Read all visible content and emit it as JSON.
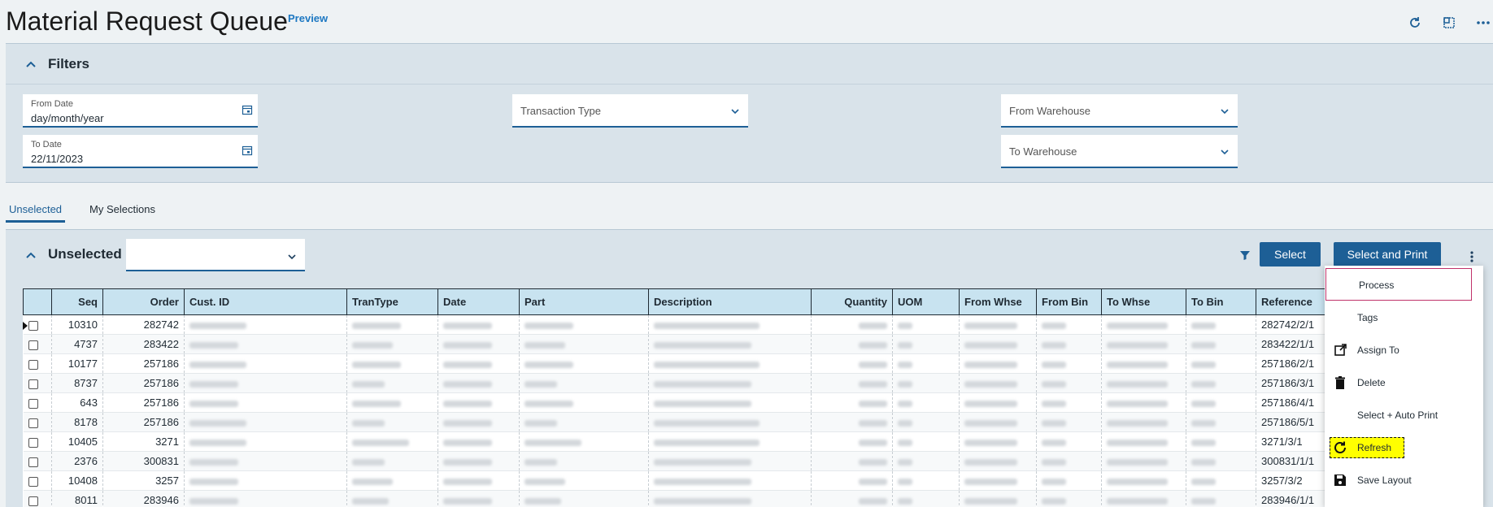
{
  "header": {
    "title": "Material Request Queue",
    "badge": "Preview",
    "icons": [
      "refresh-icon",
      "layout-icon",
      "more-icon"
    ]
  },
  "filters": {
    "title": "Filters",
    "from_date": {
      "label": "From Date",
      "value": "day/month/year"
    },
    "to_date": {
      "label": "To Date",
      "value": "22/11/2023"
    },
    "transaction_type": {
      "placeholder": "Transaction Type"
    },
    "from_warehouse": {
      "placeholder": "From Warehouse"
    },
    "to_warehouse": {
      "placeholder": "To Warehouse"
    }
  },
  "tabs": [
    {
      "label": "Unselected",
      "active": true
    },
    {
      "label": "My Selections",
      "active": false
    }
  ],
  "unselected": {
    "title": "Unselected",
    "select_label": "Select",
    "select_print_label": "Select and Print"
  },
  "grid": {
    "columns": [
      "Seq",
      "Order",
      "Cust. ID",
      "TranType",
      "Date",
      "Part",
      "Description",
      "Quantity",
      "UOM",
      "From Whse",
      "From Bin",
      "To Whse",
      "To Bin",
      "Reference"
    ],
    "rows": [
      {
        "seq": "10310",
        "order": "282742",
        "reference": "282742/2/1"
      },
      {
        "seq": "4737",
        "order": "283422",
        "reference": "283422/1/1"
      },
      {
        "seq": "10177",
        "order": "257186",
        "reference": "257186/2/1"
      },
      {
        "seq": "8737",
        "order": "257186",
        "reference": "257186/3/1"
      },
      {
        "seq": "643",
        "order": "257186",
        "reference": "257186/4/1"
      },
      {
        "seq": "8178",
        "order": "257186",
        "reference": "257186/5/1"
      },
      {
        "seq": "10405",
        "order": "3271",
        "reference": "3271/3/1"
      },
      {
        "seq": "2376",
        "order": "300831",
        "reference": "300831/1/1"
      },
      {
        "seq": "10408",
        "order": "3257",
        "reference": "3257/3/2"
      },
      {
        "seq": "8011",
        "order": "283946",
        "reference": "283946/1/1"
      }
    ]
  },
  "menu": {
    "items": [
      {
        "label": "Process",
        "icon": ""
      },
      {
        "label": "Tags",
        "icon": ""
      },
      {
        "label": "Assign To",
        "icon": "external-link-icon"
      },
      {
        "label": "Delete",
        "icon": "trash-icon"
      },
      {
        "label": "Select + Auto Print",
        "icon": ""
      },
      {
        "label": "Refresh",
        "icon": "refresh-icon"
      },
      {
        "label": "Save Layout",
        "icon": "save-icon"
      }
    ]
  }
}
